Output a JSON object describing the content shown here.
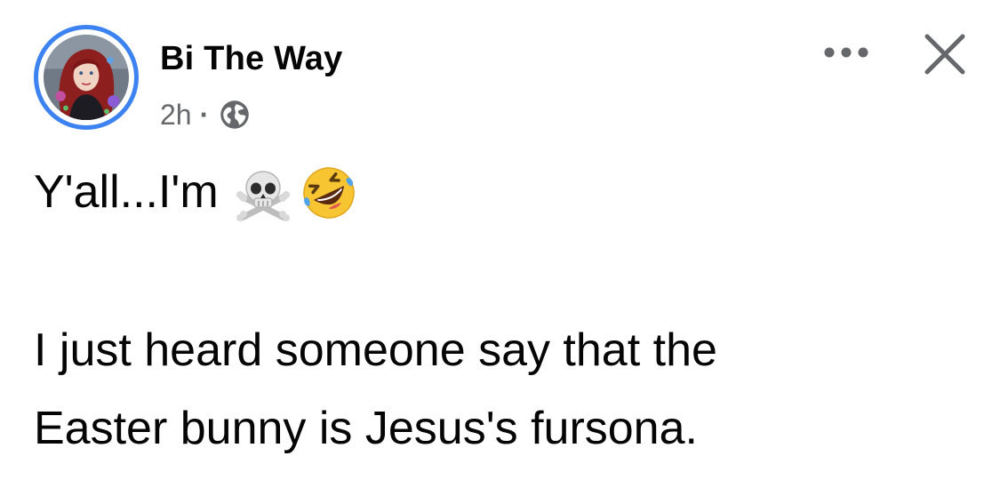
{
  "post": {
    "author": "Bi The Way",
    "timestamp": "2h",
    "separator": "·",
    "privacy_icon": "globe-icon",
    "lines": [
      "Y'all...I'm",
      "I just heard someone say that the",
      "Easter bunny is Jesus's fursona."
    ],
    "emojis": [
      "skull-and-crossbones",
      "rolling-on-floor-laughing"
    ]
  },
  "header": {
    "more_icon": "ellipsis-icon",
    "close_icon": "close-icon",
    "avatar_ring_color": "#3c82f0"
  }
}
